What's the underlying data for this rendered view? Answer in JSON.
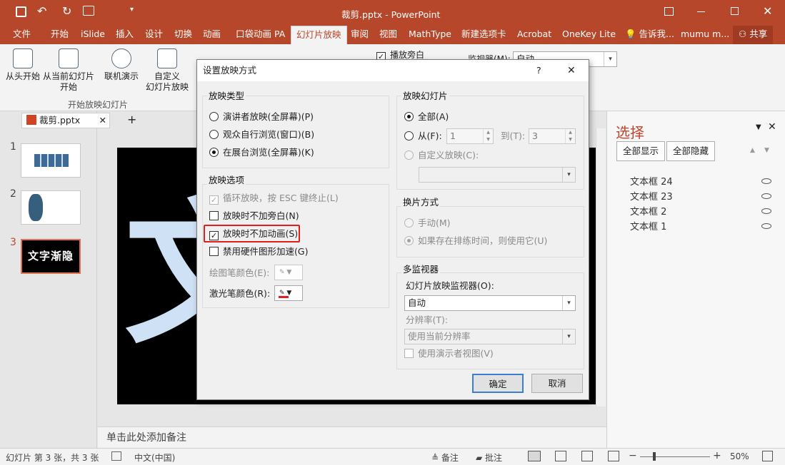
{
  "app": {
    "window_title": "裁剪.pptx - PowerPoint"
  },
  "tabs": [
    "文件",
    "开始",
    "iSlide",
    "插入",
    "设计",
    "切换",
    "动画",
    "口袋动画 PA",
    "幻灯片放映",
    "审阅",
    "视图",
    "MathType",
    "新建选项卡",
    "Acrobat",
    "OneKey Lite"
  ],
  "tellme": "告诉我...",
  "user": "mumu m...",
  "share": "共享",
  "ribbon": {
    "from_start": "从头开始",
    "from_current": [
      "从当前幻灯片",
      "开始"
    ],
    "online": "联机演示",
    "custom": [
      "自定义",
      "幻灯片放映"
    ],
    "group_label": "开始放映幻灯片",
    "narration": "播放旁白",
    "monitor_label": "监视器(M):",
    "monitor_value": "自动"
  },
  "doc_tab": "裁剪.pptx",
  "slides": [
    {
      "num": "1"
    },
    {
      "num": "2"
    },
    {
      "num": "3",
      "text": "文字渐隐"
    }
  ],
  "slide_char": "文",
  "notes_placeholder": "单击此处添加备注",
  "selection": {
    "title": "选择",
    "show_all": "全部显示",
    "hide_all": "全部隐藏",
    "layers": [
      "文本框 24",
      "文本框 23",
      "文本框 2",
      "文本框 1"
    ]
  },
  "status": {
    "slide_info": "幻灯片 第 3 张，共 3 张",
    "language": "中文(中国)",
    "notes": "备注",
    "comments": "批注",
    "zoom": "50%"
  },
  "dialog": {
    "title": "设置放映方式",
    "help": "?",
    "show_type": {
      "label": "放映类型",
      "options": [
        "演讲者放映(全屏幕)(P)",
        "观众自行浏览(窗口)(B)",
        "在展台浏览(全屏幕)(K)"
      ]
    },
    "show_options": {
      "label": "放映选项",
      "loop": "循环放映，按 ESC 键终止(L)",
      "no_narration": "放映时不加旁白(N)",
      "no_animation": "放映时不加动画(S)",
      "no_hw_accel": "禁用硬件图形加速(G)",
      "pen_color": "绘图笔颜色(E):",
      "laser_color": "激光笔颜色(R):"
    },
    "show_slides": {
      "label": "放映幻灯片",
      "all": "全部(A)",
      "from": "从(F):",
      "from_value": "1",
      "to": "到(T):",
      "to_value": "3",
      "custom": "自定义放映(C):"
    },
    "advance": {
      "label": "换片方式",
      "manual": "手动(M)",
      "timings": "如果存在排练时间，则使用它(U)"
    },
    "monitors": {
      "label": "多监视器",
      "monitor_label": "幻灯片放映监视器(O):",
      "monitor_value": "自动",
      "resolution_label": "分辨率(T):",
      "resolution_value": "使用当前分辨率",
      "presenter_view": "使用演示者视图(V)"
    },
    "ok": "确定",
    "cancel": "取消"
  }
}
